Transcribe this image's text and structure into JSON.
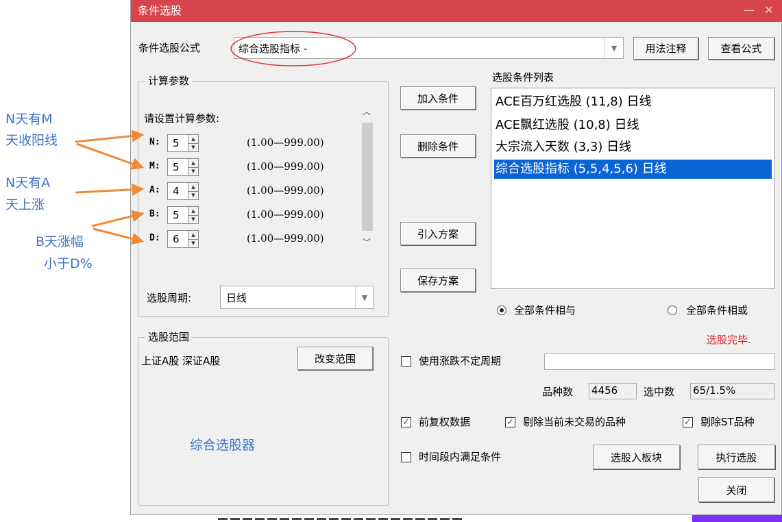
{
  "annotations": {
    "nm_line1": "N天有M",
    "nm_line2": "天收阳线",
    "na_line1": "N天有A",
    "na_line2": "天上涨",
    "bd_line1": "B天涨幅",
    "bd_line2": "小于D%"
  },
  "window": {
    "title": "条件选股",
    "minimize": "—",
    "close": "✕"
  },
  "formula": {
    "label": "条件选股公式",
    "value": "综合选股指标 -",
    "usage_button": "用法注释",
    "view_button": "查看公式"
  },
  "params": {
    "group_title": "计算参数",
    "prompt": "请设置计算参数:",
    "rows": [
      {
        "key": "N:",
        "value": "5",
        "range": "(1.00—999.00)"
      },
      {
        "key": "M:",
        "value": "5",
        "range": "(1.00—999.00)"
      },
      {
        "key": "A:",
        "value": "4",
        "range": "(1.00—999.00)"
      },
      {
        "key": "B:",
        "value": "5",
        "range": "(1.00—999.00)"
      },
      {
        "key": "D:",
        "value": "6",
        "range": "(1.00—999.00)"
      }
    ],
    "period_label": "选股周期:",
    "period_value": "日线"
  },
  "actions": {
    "add": "加入条件",
    "delete": "删除条件",
    "import": "引入方案",
    "save": "保存方案"
  },
  "condition_list": {
    "label": "选股条件列表",
    "items": [
      "ACE百万红选股 (11,8) 日线",
      "ACE飘红选股 (10,8) 日线",
      "大宗流入天数 (3,3) 日线",
      "综合选股指标 (5,5,4,5,6) 日线"
    ],
    "selected_index": 3
  },
  "logic": {
    "and_label": "全部条件相与",
    "or_label": "全部条件相或",
    "selected": "and"
  },
  "status": {
    "done": "选股完毕.",
    "color": "#e02020"
  },
  "range": {
    "group_title": "选股范围",
    "value": "上证A股 深证A股",
    "change_button": "改变范围",
    "tool_name": "综合选股器"
  },
  "options": {
    "uncertain_period_label": "使用涨跌不定周期",
    "uncertain_period_checked": false,
    "count_label": "品种数",
    "count_value": "4456",
    "selected_label": "选中数",
    "selected_value": "65/1.5%",
    "fq_label": "前复权数据",
    "fq_checked": true,
    "exclude_untraded_label": "剔除当前未交易的品种",
    "exclude_untraded_checked": true,
    "exclude_st_label": "剔除ST品种",
    "exclude_st_checked": true,
    "time_period_label": "时间段内满足条件",
    "time_period_checked": false
  },
  "bottom_buttons": {
    "to_block": "选股入板块",
    "execute": "执行选股",
    "close": "关闭"
  },
  "colors": {
    "title_bar": "#d5454b",
    "annotation_text": "#3f73c8",
    "arrow": "#f08a38",
    "highlight_circle": "#e03030",
    "selection": "#0a64d6",
    "purple_corner": "#7b2ff7"
  }
}
